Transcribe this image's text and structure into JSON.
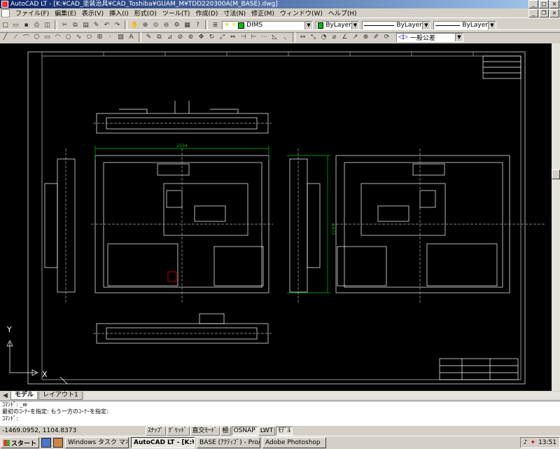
{
  "window": {
    "title": "AutoCAD LT - [K:¥CAD_塗装治具¥CAD_Toshiba¥GUAM_M¥TDD220300A(M_BASE).dwg]"
  },
  "menu": {
    "items": [
      "ファイル(F)",
      "編集(E)",
      "表示(V)",
      "挿入(I)",
      "形式(O)",
      "ツール(T)",
      "作成(D)",
      "寸法(N)",
      "修正(M)",
      "ウィンドウ(W)",
      "ヘルプ(H)"
    ]
  },
  "toolbar": {
    "layer_value": "DIMS",
    "color_value": "ByLayer",
    "linetype_value": "ByLayer",
    "lineweight_value": "ByLayer",
    "style_value": "一般公差",
    "colors": {
      "accent_green": "#00c000"
    }
  },
  "layout_tabs": [
    "モデル",
    "レイアウト1"
  ],
  "command": {
    "line1": "ｺﾏﾝﾄﾞ: _w",
    "line2": "最初のｺｰﾅｰを指定: もう一方のｺｰﾅｰを指定:",
    "line3": "ｺﾏﾝﾄﾞ:"
  },
  "status": {
    "coordinates": "-1469.0952, 1104.8373",
    "toggles": [
      "ｽﾅｯﾌﾟ",
      "ｸﾞﾘｯﾄﾞ",
      "直交ﾓｰﾄﾞ",
      "極",
      "OSNAP",
      "LWT",
      "ﾓﾃﾞﾙ"
    ]
  },
  "taskbar": {
    "start": "スタート",
    "tasks": [
      "Windows タスク マネージャ",
      "AutoCAD LT - [K:¥C...",
      "BASE (ｱｸﾃｨﾌﾞ) - Pro/E...",
      "Adobe Photoshop"
    ],
    "clock": "13:51"
  },
  "drawing": {
    "dim_width": "2534",
    "dim_height": "1672",
    "ucs_y": "Y",
    "ucs_x": "X"
  }
}
